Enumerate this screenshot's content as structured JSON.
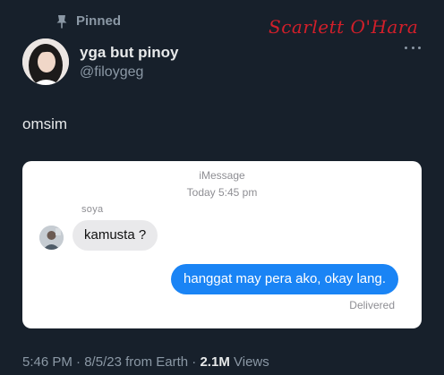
{
  "pinned": {
    "label": "Pinned",
    "icon": "pin-icon"
  },
  "watermark": "Scarlett O'Hara",
  "author": {
    "display_name": "yga but pinoy",
    "handle": "@filoygeg"
  },
  "tweet": {
    "text": "omsim"
  },
  "imessage": {
    "service_label": "iMessage",
    "timestamp": "Today 5:45 pm",
    "sender_name": "soya",
    "incoming_message": "kamusta ?",
    "outgoing_message": "hanggat may pera ako, okay lang.",
    "status": "Delivered",
    "colors": {
      "incoming_bubble": "#e9e9eb",
      "outgoing_bubble": "#1a84f5"
    }
  },
  "meta": {
    "time": "5:46 PM",
    "separator": "·",
    "date": "8/5/23 from Earth",
    "views_count": "2.1M",
    "views_label": "Views"
  },
  "colors": {
    "background": "#17202b",
    "secondary_text": "#8b98a5",
    "watermark": "#d21f2a"
  }
}
